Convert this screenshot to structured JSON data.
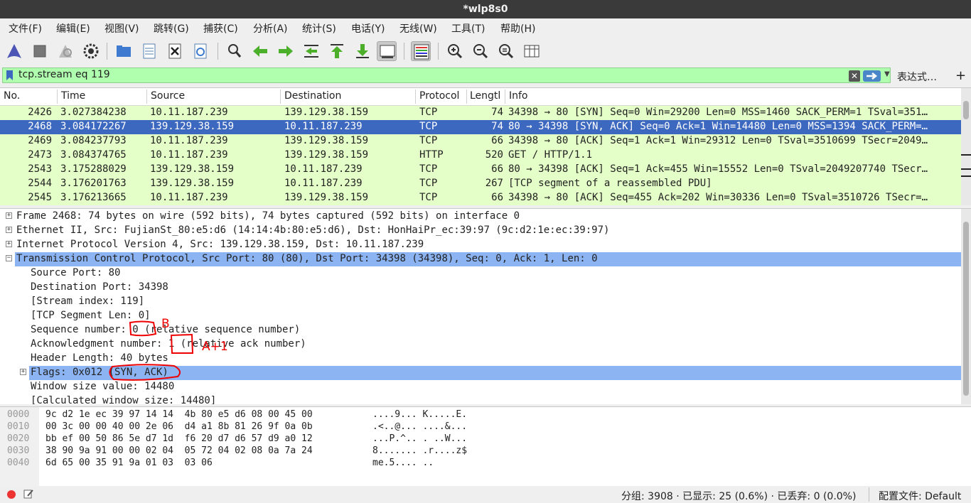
{
  "window": {
    "title": "*wlp8s0"
  },
  "menu": [
    "文件(F)",
    "编辑(E)",
    "视图(V)",
    "跳转(G)",
    "捕获(C)",
    "分析(A)",
    "统计(S)",
    "电话(Y)",
    "无线(W)",
    "工具(T)",
    "帮助(H)"
  ],
  "toolbar": {
    "icons": [
      "shark-fin-start-icon",
      "stop-icon",
      "restart-icon",
      "gear-options-icon",
      "open-folder-icon",
      "file-icon",
      "close-file-icon",
      "reload-icon",
      "search-icon",
      "back-arrow-icon",
      "forward-arrow-icon",
      "goto-packet-icon",
      "first-packet-icon",
      "last-packet-icon",
      "autoscroll-icon",
      "colorize-icon",
      "zoom-in-icon",
      "zoom-out-icon",
      "zoom-reset-icon",
      "resize-columns-icon"
    ]
  },
  "filter": {
    "value": "tcp.stream eq 119",
    "expression_label": "表达式…",
    "add_label": "+",
    "clear_label": "✕",
    "bg_color": "#afffaf"
  },
  "packet_list": {
    "columns": [
      "No.",
      "Time",
      "Source",
      "Destination",
      "Protocol",
      "Lengtl",
      "Info"
    ],
    "rows": [
      {
        "no": "2426",
        "time": "3.027384238",
        "source": "10.11.187.239",
        "destination": "139.129.38.159",
        "protocol": "TCP",
        "length": "74",
        "info": "34398 → 80 [SYN] Seq=0 Win=29200 Len=0 MSS=1460 SACK_PERM=1 TSval=351…"
      },
      {
        "no": "2468",
        "time": "3.084172267",
        "source": "139.129.38.159",
        "destination": "10.11.187.239",
        "protocol": "TCP",
        "length": "74",
        "info": "80 → 34398 [SYN, ACK] Seq=0 Ack=1 Win=14480 Len=0 MSS=1394 SACK_PERM=…"
      },
      {
        "no": "2469",
        "time": "3.084237793",
        "source": "10.11.187.239",
        "destination": "139.129.38.159",
        "protocol": "TCP",
        "length": "66",
        "info": "34398 → 80 [ACK] Seq=1 Ack=1 Win=29312 Len=0 TSval=3510699 TSecr=2049…"
      },
      {
        "no": "2473",
        "time": "3.084374765",
        "source": "10.11.187.239",
        "destination": "139.129.38.159",
        "protocol": "HTTP",
        "length": "520",
        "info": "GET / HTTP/1.1"
      },
      {
        "no": "2543",
        "time": "3.175288029",
        "source": "139.129.38.159",
        "destination": "10.11.187.239",
        "protocol": "TCP",
        "length": "66",
        "info": "80 → 34398 [ACK] Seq=1 Ack=455 Win=15552 Len=0 TSval=2049207740 TSecr…"
      },
      {
        "no": "2544",
        "time": "3.176201763",
        "source": "139.129.38.159",
        "destination": "10.11.187.239",
        "protocol": "TCP",
        "length": "267",
        "info": "[TCP segment of a reassembled PDU]"
      },
      {
        "no": "2545",
        "time": "3.176213665",
        "source": "10.11.187.239",
        "destination": "139.129.38.159",
        "protocol": "TCP",
        "length": "66",
        "info": "34398 → 80 [ACK] Seq=455 Ack=202 Win=30336 Len=0 TSval=3510726 TSecr=…"
      }
    ],
    "selected_no": "2468",
    "row_color": "#e4ffc7",
    "selected_color": "#3d68bf"
  },
  "details": {
    "lines": [
      {
        "text": "Frame 2468: 74 bytes on wire (592 bits), 74 bytes captured (592 bits) on interface 0",
        "indent": 0,
        "expander": "+"
      },
      {
        "text": "Ethernet II, Src: FujianSt_80:e5:d6 (14:14:4b:80:e5:d6), Dst: HonHaiPr_ec:39:97 (9c:d2:1e:ec:39:97)",
        "indent": 0,
        "expander": "+"
      },
      {
        "text": "Internet Protocol Version 4, Src: 139.129.38.159, Dst: 10.11.187.239",
        "indent": 0,
        "expander": "+"
      },
      {
        "text": "Transmission Control Protocol, Src Port: 80 (80), Dst Port: 34398 (34398), Seq: 0, Ack: 1, Len: 0",
        "indent": 0,
        "expander": "−",
        "highlight": true
      },
      {
        "text": "Source Port: 80",
        "indent": 1,
        "expander": ""
      },
      {
        "text": "Destination Port: 34398",
        "indent": 1,
        "expander": ""
      },
      {
        "text": "[Stream index: 119]",
        "indent": 1,
        "expander": ""
      },
      {
        "text": "[TCP Segment Len: 0]",
        "indent": 1,
        "expander": ""
      },
      {
        "text": "Sequence number: 0    (relative sequence number)",
        "indent": 1,
        "expander": ""
      },
      {
        "text": "Acknowledgment number: 1    (relative ack number)",
        "indent": 1,
        "expander": ""
      },
      {
        "text": "Header Length: 40 bytes",
        "indent": 1,
        "expander": ""
      },
      {
        "text": "Flags: 0x012 (SYN, ACK)",
        "indent": 1,
        "expander": "+",
        "highlight": true
      },
      {
        "text": "Window size value: 14480",
        "indent": 1,
        "expander": ""
      },
      {
        "text": "[Calculated window size: 14480]",
        "indent": 1,
        "expander": ""
      }
    ]
  },
  "hex": {
    "offsets": [
      "0000",
      "0010",
      "0020",
      "0030",
      "0040"
    ],
    "bytes": [
      "9c d2 1e ec 39 97 14 14  4b 80 e5 d6 08 00 45 00",
      "00 3c 00 00 40 00 2e 06  d4 a1 8b 81 26 9f 0a 0b",
      "bb ef 00 50 86 5e d7 1d  f6 20 d7 d6 57 d9 a0 12",
      "38 90 9a 91 00 00 02 04  05 72 04 02 08 0a 7a 24",
      "6d 65 00 35 91 9a 01 03  03 06"
    ],
    "ascii": [
      "....9... K.....E.",
      ".<..@... ....&...",
      "...P.^.. . ..W...",
      "8....... .r....z$",
      "me.5.... .."
    ]
  },
  "status": {
    "packets": "分组: 3908 · 已显示: 25 (0.6%) · 已丢弃: 0 (0.0%)",
    "profile": "配置文件: Default"
  },
  "annotations": {
    "seq_label": "B",
    "ack_label": "A+1",
    "color": "#e00000"
  }
}
